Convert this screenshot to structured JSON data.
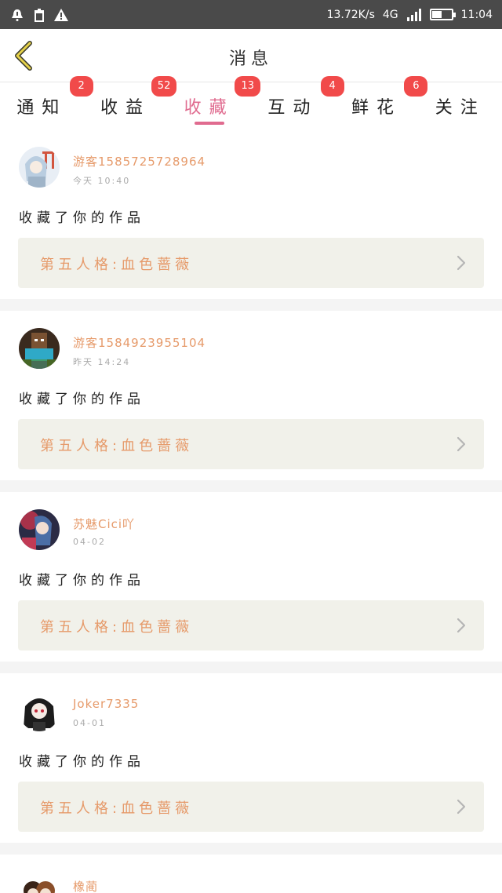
{
  "status_bar": {
    "speed": "13.72K/s",
    "network": "4G",
    "time": "11:04",
    "battery_level": 0.5
  },
  "header": {
    "title": "消息"
  },
  "tabs": [
    {
      "label": "通知",
      "badge": "2",
      "active": false
    },
    {
      "label": "收益",
      "badge": "52",
      "active": false
    },
    {
      "label": "收藏",
      "badge": "13",
      "active": true
    },
    {
      "label": "互动",
      "badge": "4",
      "active": false
    },
    {
      "label": "鲜花",
      "badge": "6",
      "active": false
    },
    {
      "label": "关注",
      "badge": "",
      "active": false
    }
  ],
  "items": [
    {
      "username": "游客1585725728964",
      "time": "今天 10:40",
      "action": "收藏了你的作品",
      "work": "第五人格:血色蔷薇",
      "avatar": "avatar-anime-girl-red-gate"
    },
    {
      "username": "游客1584923955104",
      "time": "昨天 14:24",
      "action": "收藏了你的作品",
      "work": "第五人格:血色蔷薇",
      "avatar": "avatar-minecraft-steve"
    },
    {
      "username": "苏魅Cici吖",
      "time": "04-02",
      "action": "收藏了你的作品",
      "work": "第五人格:血色蔷薇",
      "avatar": "avatar-anime-red-blue"
    },
    {
      "username": "Joker7335",
      "time": "04-01",
      "action": "收藏了你的作品",
      "work": "第五人格:血色蔷薇",
      "avatar": "avatar-anime-black-hair"
    },
    {
      "username": "橡蔺",
      "time": "",
      "action": "",
      "work": "",
      "avatar": "avatar-anime-pair"
    }
  ],
  "colors": {
    "accent": "#e06b8f",
    "username": "#e69a6a",
    "badge": "#f14a4a",
    "work_box": "#f1f1ea"
  }
}
